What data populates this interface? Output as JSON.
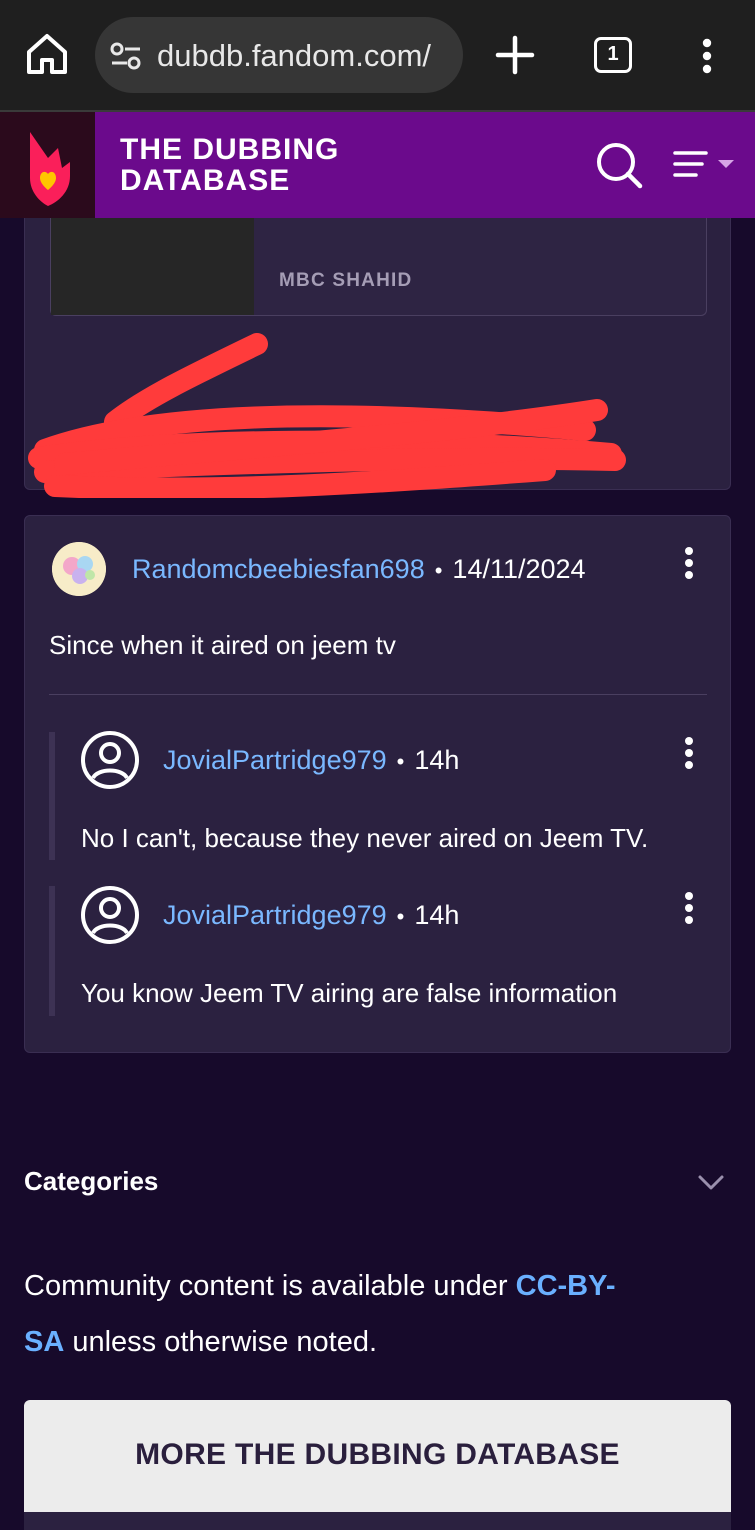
{
  "browser": {
    "url": "dubdb.fandom.com/",
    "tab_count": "1",
    "icons": [
      "home-icon",
      "site-info-icon",
      "new-tab-icon",
      "tab-switcher-icon",
      "overflow-menu-icon"
    ]
  },
  "site": {
    "title_line1": "THE DUBBING",
    "title_line2": "DATABASE",
    "colors": {
      "header": "#6b0a8c",
      "link": "#7ab8ff",
      "background": "#170a2b"
    }
  },
  "top_card": {
    "channel": "MBC SHAHID"
  },
  "comment": {
    "author": "Randomcbeebiesfan698",
    "date": "14/11/2024",
    "text": "Since when it aired on jeem tv",
    "replies": [
      {
        "author": "JovialPartridge979",
        "time": "14h",
        "text": "No I can't, because they never aired on Jeem TV."
      },
      {
        "author": "JovialPartridge979",
        "time": "14h",
        "text": "You know Jeem TV airing are false information"
      }
    ]
  },
  "categories": {
    "title": "Categories"
  },
  "license": {
    "prefix": "Community content is available under ",
    "link_part1": "CC-BY-",
    "link_part2": "SA",
    "suffix": " unless otherwise noted."
  },
  "more_button": {
    "label": "MORE THE DUBBING DATABASE"
  }
}
